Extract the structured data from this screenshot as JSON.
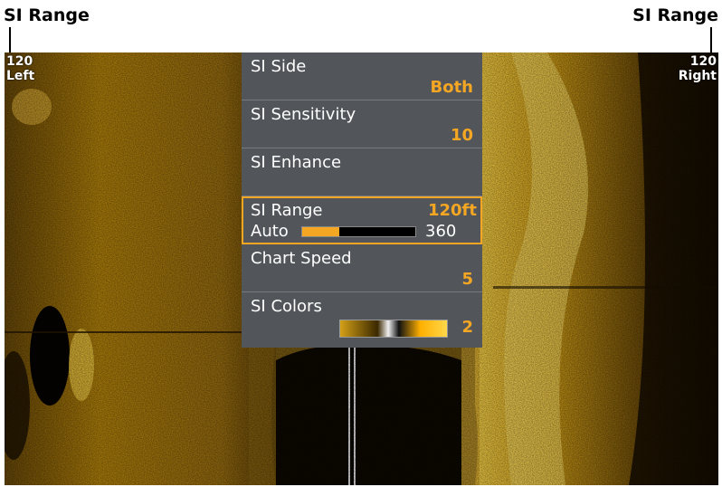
{
  "callouts": {
    "left": "SI Range",
    "right": "SI Range"
  },
  "range_labels": {
    "left_value": "120",
    "left_side": "Left",
    "right_value": "120",
    "right_side": "Right"
  },
  "menu": {
    "items": [
      {
        "label": "SI Side",
        "value": "Both"
      },
      {
        "label": "SI Sensitivity",
        "value": "10"
      },
      {
        "label": "SI Enhance",
        "value": ""
      },
      {
        "label": "SI Range",
        "value": "120ft",
        "sub_label": "Auto",
        "sub_max": "360",
        "level": 0.33
      },
      {
        "label": "Chart Speed",
        "value": "5"
      },
      {
        "label": "SI Colors",
        "value": "2"
      }
    ],
    "selected_index": 3
  },
  "colors": {
    "accent": "#f5a623",
    "menu_bg": "#52565a",
    "sonar_bright": "#f4c430",
    "sonar_dark": "#0a0600"
  }
}
